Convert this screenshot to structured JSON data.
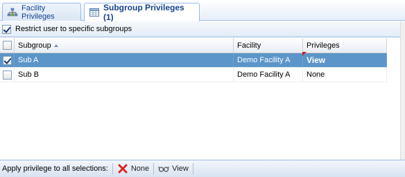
{
  "tabs": [
    {
      "label": "Facility Privileges",
      "icon": "hierarchy-icon"
    },
    {
      "label": "Subgroup Privileges (1)",
      "icon": "grid-icon"
    }
  ],
  "restrict": {
    "label": "Restrict user to specific subgroups",
    "checked": true
  },
  "grid": {
    "columns": [
      "Subgroup",
      "Facility",
      "Privileges"
    ],
    "sort": {
      "column": "Subgroup",
      "direction": "asc"
    },
    "rows": [
      {
        "checked": true,
        "subgroup": "Sub A",
        "facility": "Demo Facility A",
        "privileges": "View",
        "selected": true
      },
      {
        "checked": false,
        "subgroup": "Sub B",
        "facility": "Demo Facility A",
        "privileges": "None",
        "selected": false
      }
    ]
  },
  "toolbar": {
    "label": "Apply privilege to all selections:",
    "none_label": "None",
    "view_label": "View"
  },
  "colors": {
    "selected_row": "#5b95c9",
    "tab_text": "#15428b",
    "border": "#99bbe8"
  }
}
